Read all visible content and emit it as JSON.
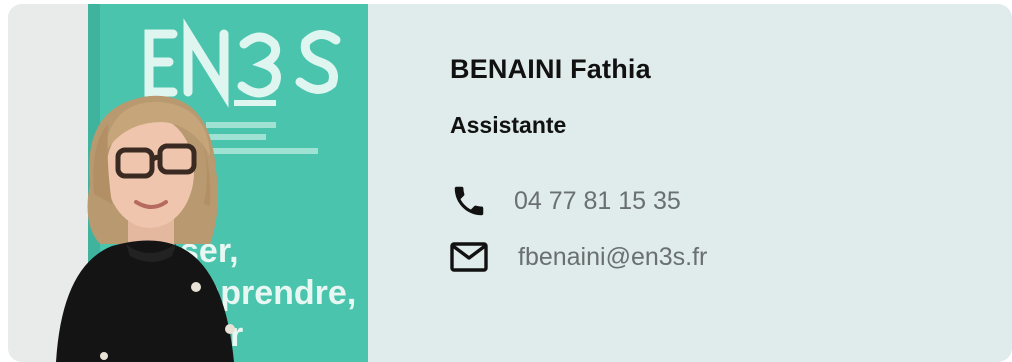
{
  "profile": {
    "name": "BENAINI Fathia",
    "role": "Assistante",
    "phone": "04 77 81 15 35",
    "email": "fbenaini@en3s.fr"
  },
  "banner": {
    "logo_text": "EN3S",
    "slogan_fragments": [
      "ser,",
      "mprendre,",
      "r"
    ]
  },
  "icons": {
    "phone": "phone-icon",
    "email": "mail-icon"
  },
  "colors": {
    "card_background": "#dfeceb",
    "banner_green": "#4bc4ad",
    "text_primary": "#111111",
    "text_secondary": "#6a6f70"
  }
}
